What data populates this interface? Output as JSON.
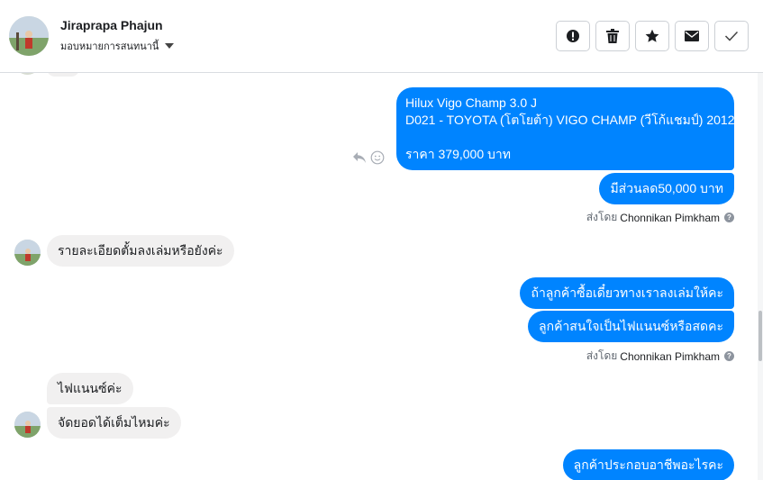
{
  "header": {
    "contact_name": "Jiraprapa Phajun",
    "assign_label": "มอบหมายการสนทนานี้",
    "actions": [
      {
        "name": "mark-spam",
        "icon": "alert-circle-icon"
      },
      {
        "name": "delete",
        "icon": "trash-icon"
      },
      {
        "name": "star",
        "icon": "star-icon"
      },
      {
        "name": "mark-unread",
        "icon": "envelope-icon"
      },
      {
        "name": "done",
        "icon": "check-icon"
      }
    ]
  },
  "messages": {
    "m1": {
      "line1": "Hilux Vigo Champ 3.0 J",
      "line2": "D021 - TOYOTA (โตโยต้า) VIGO CHAMP (วีโก้แชมป์) 2012",
      "line3": "ราคา 379,000 บาท"
    },
    "m2": "มีส่วนลด50,000 บาท",
    "sent1": {
      "prefix": "ส่งโดย",
      "name": "Chonnikan Pimkham"
    },
    "m3": "รายละเอียดตั้มลงเล่มหรือยังค่ะ",
    "m4": "ถ้าลูกค้าซื้อเดี๋ยวทางเราลงเล่มให้คะ",
    "m5": "ลูกค้าสนใจเป็นไฟแนนซ์หรือสดคะ",
    "sent2": {
      "prefix": "ส่งโดย",
      "name": "Chonnikan Pimkham"
    },
    "m6": "ไฟแนนซ์ค่ะ",
    "m7": "จัดยอดได้เต็มไหมค่ะ",
    "m8": "ลูกค้าประกอบอาชีพอะไรคะ"
  },
  "colors": {
    "outgoing": "#0084ff",
    "incoming": "#f1f0f0"
  }
}
